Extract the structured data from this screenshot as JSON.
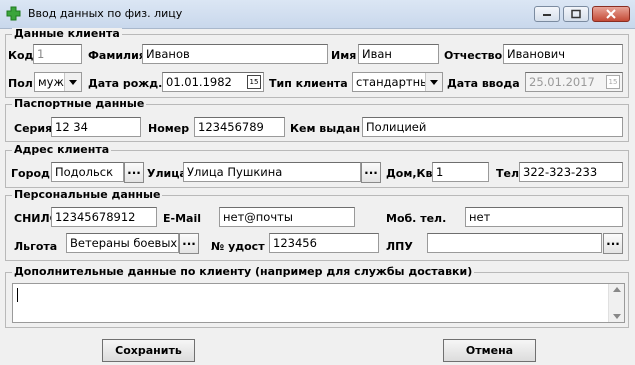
{
  "window": {
    "title": "Ввод данных по физ. лицу",
    "controls": [
      "minimize-icon",
      "maximize-icon",
      "close-icon"
    ]
  },
  "client": {
    "legend": "Данные клиента",
    "code_label": "Код",
    "code_value": "1",
    "lastname_label": "Фамилия",
    "lastname_value": "Иванов",
    "firstname_label": "Имя",
    "firstname_value": "Иван",
    "patronymic_label": "Отчество",
    "patronymic_value": "Иванович",
    "sex_label": "Пол",
    "sex_value": "муж",
    "birthdate_label": "Дата рожд.",
    "birthdate_value": "01.01.1982",
    "client_type_label": "Тип клиента",
    "client_type_value": "стандартный",
    "entry_date_label": "Дата ввода",
    "entry_date_value": "25.01.2017",
    "calendar_glyph": "15"
  },
  "passport": {
    "legend": "Паспортные данные",
    "series_label": "Серия",
    "series_value": "12 34",
    "number_label": "Номер",
    "number_value": "123456789",
    "issued_label": "Кем выдан",
    "issued_value": "Полицией"
  },
  "address": {
    "legend": "Адрес клиента",
    "city_label": "Город",
    "city_value": "Подольск",
    "street_label": "Улица",
    "street_value": "Улица Пушкина",
    "house_label": "Дом,Кв",
    "house_value": "1",
    "phone_label": "Тел",
    "phone_value": "322-323-233",
    "browse_label": "..."
  },
  "personal": {
    "legend": "Персональные данные",
    "snils_label": "СНИЛС",
    "snils_value": "12345678912",
    "email_label": "E-Mail",
    "email_value": "нет@почты",
    "mobile_label": "Моб. тел.",
    "mobile_value": "нет",
    "benefit_label": "Льгота",
    "benefit_value": "Ветераны боевых д",
    "cert_label": "№ удост",
    "cert_value": "123456",
    "lpu_label": "ЛПУ",
    "lpu_value": "",
    "browse_label": "..."
  },
  "extra": {
    "legend": "Дополнительные данные по клиенту (например для службы доставки)",
    "value": ""
  },
  "buttons": {
    "save_label": "Сохранить",
    "cancel_label": "Отмена"
  },
  "colors": {
    "titlebar": "#c9d8ec",
    "close_button": "#c44a36",
    "app_icon": "#3ba53b"
  }
}
